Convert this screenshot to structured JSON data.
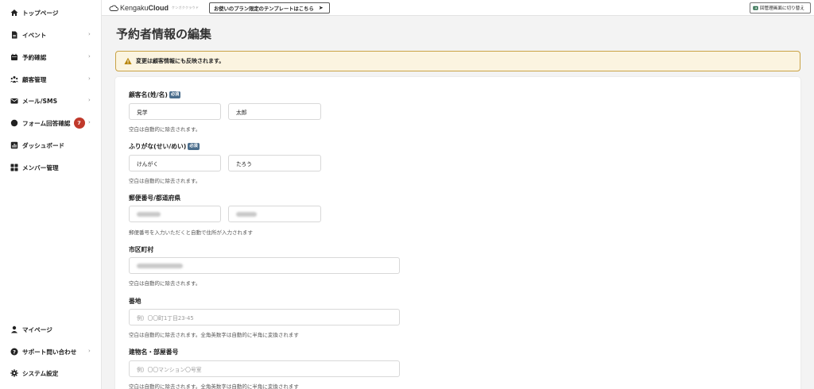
{
  "sidebar": {
    "items": [
      {
        "label": "トップページ",
        "icon": "home-icon",
        "chevron": false
      },
      {
        "label": "イベント",
        "icon": "document-icon",
        "chevron": true
      },
      {
        "label": "予約確認",
        "icon": "calendar-icon",
        "chevron": true
      },
      {
        "label": "顧客管理",
        "icon": "users-icon",
        "chevron": true
      },
      {
        "label": "メール/SMS",
        "icon": "mail-icon",
        "chevron": true
      },
      {
        "label": "フォーム回答確認",
        "icon": "chat-icon",
        "chevron": true,
        "badge": "7"
      },
      {
        "label": "ダッシュボード",
        "icon": "chart-icon",
        "chevron": false
      },
      {
        "label": "メンバー管理",
        "icon": "grid-icon",
        "chevron": false
      }
    ],
    "bottom_items": [
      {
        "label": "マイページ",
        "icon": "person-icon",
        "chevron": false
      },
      {
        "label": "サポート問い合わせ",
        "icon": "help-icon",
        "chevron": true
      },
      {
        "label": "システム設定",
        "icon": "gear-icon",
        "chevron": false
      }
    ]
  },
  "topbar": {
    "brand_light": "Kengaku",
    "brand_bold": "Cloud",
    "brand_sub": "ケンガククラウド",
    "template_button": "お使いのプラン限定のテンプレートはこちら",
    "switch_button": "回管理画面に切り替え"
  },
  "page": {
    "title": "予約者情報の編集",
    "alert": "変更は顧客情報にも反映されます。"
  },
  "form": {
    "required_badge": "必須",
    "name": {
      "label": "顧客名(姓/名)",
      "last": "見学",
      "first": "太郎",
      "hint": "空白は自動的に除去されます。"
    },
    "kana": {
      "label": "ふりがな(せい/めい)",
      "last": "けんがく",
      "first": "たろう",
      "hint": "空白は自動的に除去されます。"
    },
    "postal": {
      "label": "郵便番号/都道府県",
      "hint": "郵便番号を入力いただくと自動で住所が入力されます"
    },
    "city": {
      "label": "市区町村",
      "hint": "空白は自動的に除去されます。"
    },
    "street": {
      "label": "番地",
      "placeholder": "例）〇〇町1丁目23-45",
      "hint": "空白は自動的に除去されます。全角英数字は自動的に半角に変換されます"
    },
    "building": {
      "label": "建物名・部屋番号",
      "placeholder": "例）〇〇マンション〇号室",
      "hint": "空白は自動的に除去されます。全角英数字は自動的に半角に変換されます"
    }
  },
  "colors": {
    "alert_bg": "#fbf4e0",
    "alert_border": "#c9a245",
    "badge_red": "#c0392b",
    "required_blue": "#4a6d8c"
  }
}
